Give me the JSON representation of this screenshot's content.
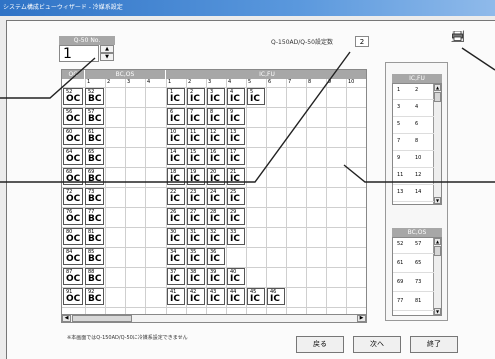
{
  "window": {
    "title": "システム構成ビューウィザード - 冷媒系設定"
  },
  "q50": {
    "label": "Q-50 No.",
    "value": "1"
  },
  "q150": {
    "label": "Q-150AD/Q-50設定数",
    "value": "2"
  },
  "grid": {
    "header_oc": "OC",
    "header_bcos": "BC,OS",
    "header_icfu": "IC,FU",
    "col_numbers": [
      "1",
      "2",
      "3",
      "4",
      "1",
      "2",
      "3",
      "4",
      "5",
      "6",
      "7",
      "8",
      "9",
      "10"
    ],
    "rows": [
      {
        "oc": [
          "OC",
          "52"
        ],
        "bc": [
          "BC",
          "52"
        ],
        "ic": [
          [
            "1",
            "IC"
          ],
          [
            "2",
            "IC"
          ],
          [
            "3",
            "IC"
          ],
          [
            "4",
            "IC"
          ],
          [
            "5",
            "IC"
          ]
        ],
        "oc_n": "1"
      },
      {
        "oc": [
          "OC",
          "56"
        ],
        "bc": [
          "BC",
          "57"
        ],
        "ic": [
          [
            "6",
            "IC"
          ],
          [
            "7",
            "IC"
          ],
          [
            "8",
            "IC"
          ],
          [
            "9",
            "IC"
          ]
        ]
      },
      {
        "oc": [
          "OC",
          "60"
        ],
        "bc": [
          "BC",
          "61"
        ],
        "ic": [
          [
            "10",
            "IC"
          ],
          [
            "11",
            "IC"
          ],
          [
            "12",
            "IC"
          ],
          [
            "13",
            "IC"
          ]
        ]
      },
      {
        "oc": [
          "OC",
          "64"
        ],
        "bc": [
          "BC",
          "65"
        ],
        "ic": [
          [
            "14",
            "IC"
          ],
          [
            "15",
            "IC"
          ],
          [
            "16",
            "IC"
          ],
          [
            "17",
            "IC"
          ]
        ]
      },
      {
        "oc": [
          "OC",
          "68"
        ],
        "bc": [
          "BC",
          "69"
        ],
        "ic": [
          [
            "18",
            "IC"
          ],
          [
            "19",
            "IC"
          ],
          [
            "20",
            "IC"
          ],
          [
            "21",
            "IC"
          ]
        ]
      },
      {
        "oc": [
          "OC",
          "72"
        ],
        "bc": [
          "BC",
          "73"
        ],
        "ic": [
          [
            "22",
            "IC"
          ],
          [
            "23",
            "IC"
          ],
          [
            "24",
            "IC"
          ],
          [
            "25",
            "IC"
          ]
        ]
      },
      {
        "oc": [
          "OC",
          "76"
        ],
        "bc": [
          "BC",
          "77"
        ],
        "ic": [
          [
            "26",
            "IC"
          ],
          [
            "27",
            "IC"
          ],
          [
            "28",
            "IC"
          ],
          [
            "29",
            "IC"
          ]
        ]
      },
      {
        "oc": [
          "OC",
          "80"
        ],
        "bc": [
          "BC",
          "81"
        ],
        "ic": [
          [
            "30",
            "IC"
          ],
          [
            "31",
            "IC"
          ],
          [
            "32",
            "IC"
          ],
          [
            "33",
            "IC"
          ]
        ]
      },
      {
        "oc": [
          "OC",
          "84"
        ],
        "bc": [
          "BC",
          "85"
        ],
        "ic": [
          [
            "34",
            "IC"
          ],
          [
            "35",
            "IC"
          ],
          [
            "36",
            "IC"
          ]
        ]
      },
      {
        "oc": [
          "OC",
          "87"
        ],
        "bc": [
          "BC",
          "88"
        ],
        "ic": [
          [
            "37",
            "IC"
          ],
          [
            "38",
            "IC"
          ],
          [
            "39",
            "IC"
          ],
          [
            "40",
            "IC"
          ]
        ]
      },
      {
        "oc": [
          "OC",
          "91"
        ],
        "bc": [
          "BC",
          "92"
        ],
        "ic": [
          [
            "41",
            "IC"
          ],
          [
            "42",
            "IC"
          ],
          [
            "43",
            "IC"
          ],
          [
            "44",
            "IC"
          ],
          [
            "45",
            "IC"
          ],
          [
            "46",
            "IC"
          ]
        ]
      }
    ]
  },
  "icfu_panel": {
    "header": "IC,FU",
    "rows": [
      [
        "1",
        "2"
      ],
      [
        "3",
        "4"
      ],
      [
        "5",
        "6"
      ],
      [
        "7",
        "8"
      ],
      [
        "9",
        "10"
      ],
      [
        "11",
        "12"
      ],
      [
        "13",
        "14"
      ]
    ]
  },
  "bcos_panel": {
    "header": "BC,OS",
    "rows": [
      [
        "52",
        "57"
      ],
      [
        "61",
        "65"
      ],
      [
        "69",
        "73"
      ],
      [
        "77",
        "81"
      ]
    ]
  },
  "note": "※本画面ではQ-150AD/Q-50に冷媒系設定できません",
  "buttons": {
    "back": "戻る",
    "next": "次へ",
    "finish": "終了"
  },
  "icons": {
    "print": "printer-icon"
  }
}
